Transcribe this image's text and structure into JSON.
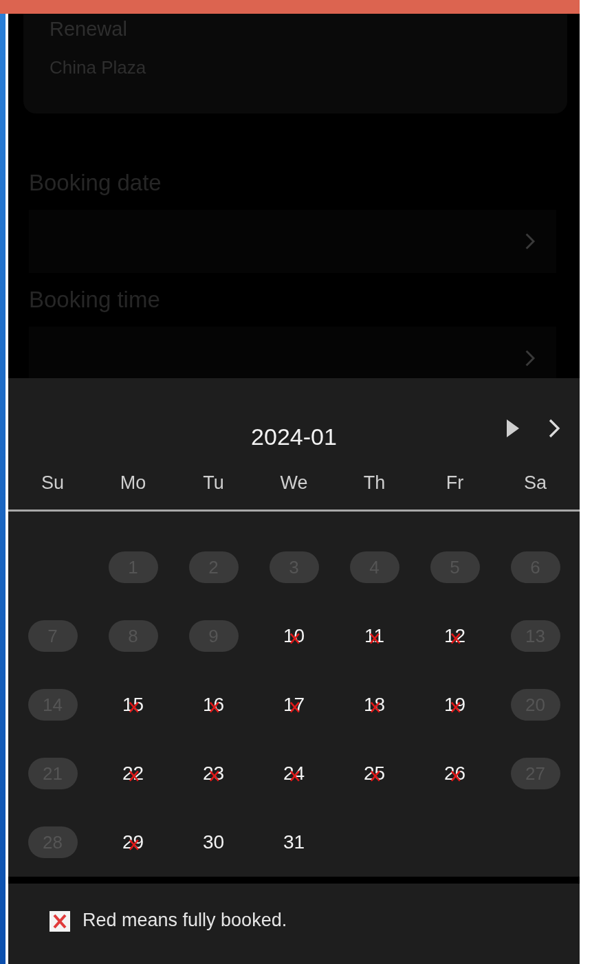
{
  "background_form": {
    "service": "Renewal",
    "location": "China Plaza",
    "fields": [
      {
        "label": "Booking date"
      },
      {
        "label": "Booking time"
      }
    ]
  },
  "calendar": {
    "month": "2024-01",
    "weekdays": [
      "Su",
      "Mo",
      "Tu",
      "We",
      "Th",
      "Fr",
      "Sa"
    ],
    "days": [
      {
        "label": "1",
        "kind": "disabled"
      },
      {
        "label": "2",
        "kind": "disabled"
      },
      {
        "label": "3",
        "kind": "disabled"
      },
      {
        "label": "4",
        "kind": "disabled"
      },
      {
        "label": "5",
        "kind": "disabled"
      },
      {
        "label": "6",
        "kind": "disabled"
      },
      {
        "label": "7",
        "kind": "disabled"
      },
      {
        "label": "8",
        "kind": "disabled"
      },
      {
        "label": "9",
        "kind": "disabled"
      },
      {
        "label": "10",
        "kind": "booked"
      },
      {
        "label": "11",
        "kind": "booked"
      },
      {
        "label": "12",
        "kind": "booked"
      },
      {
        "label": "13",
        "kind": "disabled"
      },
      {
        "label": "14",
        "kind": "disabled"
      },
      {
        "label": "15",
        "kind": "booked"
      },
      {
        "label": "16",
        "kind": "booked"
      },
      {
        "label": "17",
        "kind": "booked"
      },
      {
        "label": "18",
        "kind": "booked"
      },
      {
        "label": "19",
        "kind": "booked"
      },
      {
        "label": "20",
        "kind": "disabled"
      },
      {
        "label": "21",
        "kind": "disabled"
      },
      {
        "label": "22",
        "kind": "booked"
      },
      {
        "label": "23",
        "kind": "booked"
      },
      {
        "label": "24",
        "kind": "booked"
      },
      {
        "label": "25",
        "kind": "booked"
      },
      {
        "label": "26",
        "kind": "booked"
      },
      {
        "label": "27",
        "kind": "disabled"
      },
      {
        "label": "28",
        "kind": "disabled"
      },
      {
        "label": "29",
        "kind": "booked"
      },
      {
        "label": "30",
        "kind": "available"
      },
      {
        "label": "31",
        "kind": "available"
      }
    ]
  },
  "legend": {
    "text": "Red means fully booked."
  }
}
